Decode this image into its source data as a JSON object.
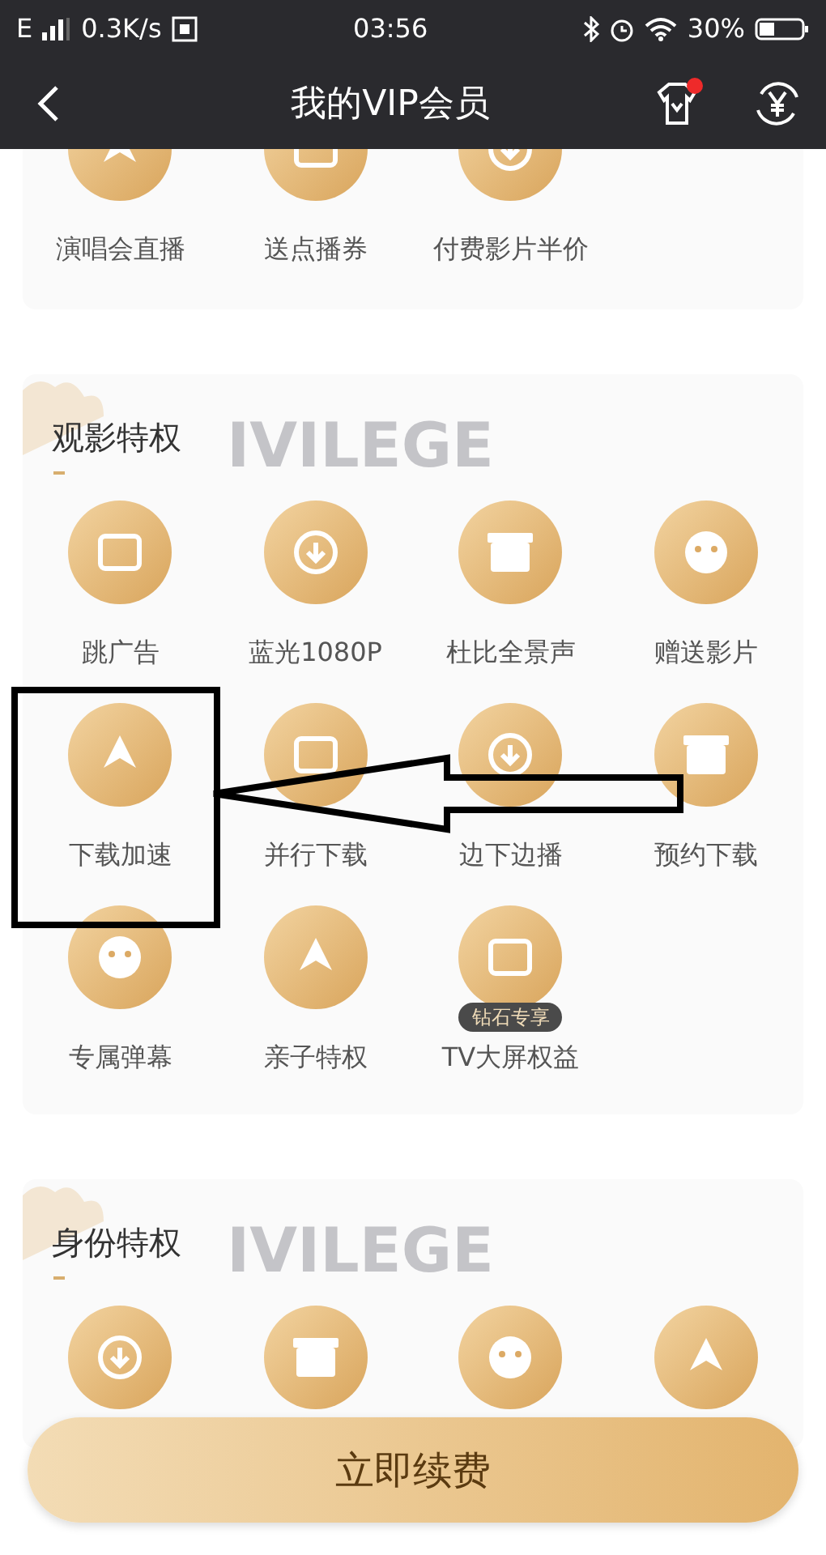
{
  "status_bar": {
    "network": "E",
    "speed": "0.3K/s",
    "time": "03:56",
    "battery": "30%"
  },
  "nav": {
    "title": "我的VIP会员",
    "notification_dot": true
  },
  "sections": [
    {
      "items": [
        {
          "kind": "labeled",
          "label": "演唱会直播"
        },
        {
          "kind": "labeled",
          "label": "送点播券"
        },
        {
          "kind": "labeled",
          "label": "付费影片半价"
        }
      ]
    },
    {
      "title": "观影特权",
      "watermark": "IVILEGE",
      "items": [
        {
          "kind": "labeled",
          "label": "跳广告"
        },
        {
          "kind": "labeled",
          "label": "蓝光1080P"
        },
        {
          "kind": "labeled",
          "label": "杜比全景声"
        },
        {
          "kind": "labeled",
          "label": "赠送影片"
        },
        {
          "kind": "labeled",
          "label": "下载加速"
        },
        {
          "kind": "labeled",
          "label": "并行下载"
        },
        {
          "kind": "labeled",
          "label": "边下边播"
        },
        {
          "kind": "labeled",
          "label": "预约下载"
        },
        {
          "kind": "labeled",
          "label": "专属弹幕"
        },
        {
          "kind": "labeled",
          "label": "亲子特权"
        },
        {
          "kind": "labeled",
          "label": "TV大屏权益",
          "badge": "钻石专享"
        }
      ]
    },
    {
      "title": "身份特权",
      "watermark": "IVILEGE",
      "items": [
        {
          "kind": "icon"
        },
        {
          "kind": "icon"
        },
        {
          "kind": "icon"
        },
        {
          "kind": "icon"
        }
      ]
    }
  ],
  "renew_button": {
    "label": "立即续费"
  }
}
